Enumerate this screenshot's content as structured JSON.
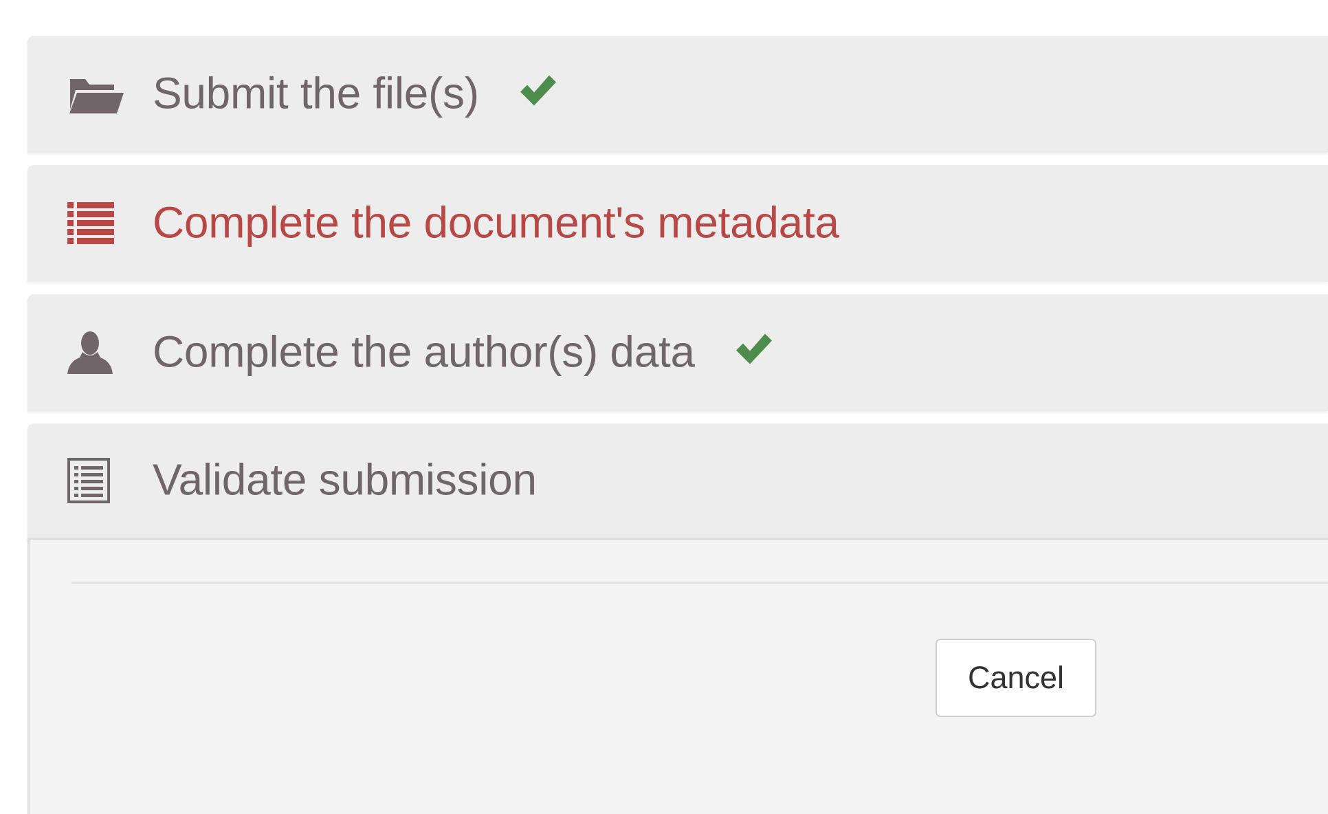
{
  "steps": [
    {
      "label": "Submit the file(s)",
      "icon": "folder-open-icon",
      "completed": true,
      "active": false
    },
    {
      "label": "Complete the document's metadata",
      "icon": "list-icon",
      "completed": false,
      "active": true
    },
    {
      "label": "Complete the author(s) data",
      "icon": "user-icon",
      "completed": true,
      "active": false
    },
    {
      "label": "Validate submission",
      "icon": "document-list-icon",
      "completed": false,
      "active": false
    }
  ],
  "actions": {
    "cancel_label": "Cancel"
  },
  "colors": {
    "step_text": "#706568",
    "active_step_text": "#b84845",
    "check": "#4e8c4b",
    "panel_bg": "#ededed",
    "body_bg": "#f4f4f4"
  }
}
